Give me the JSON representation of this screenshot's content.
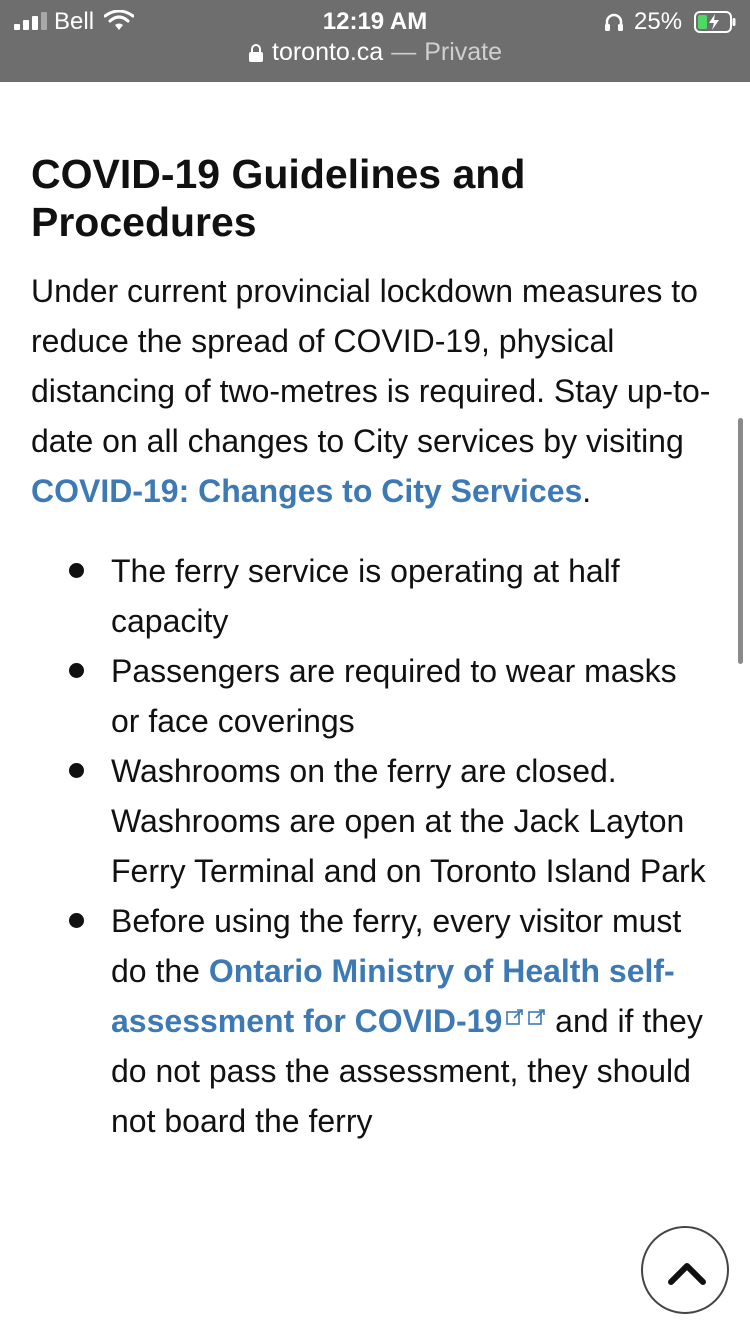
{
  "status_bar": {
    "carrier": "Bell",
    "time": "12:19 AM",
    "battery_percent": "25%",
    "signal_icon": "cellular-signal-icon",
    "wifi_icon": "wifi-icon",
    "headphones_icon": "headphones-icon",
    "battery_icon": "battery-charging-icon"
  },
  "url_bar": {
    "domain": "toronto.ca",
    "separator": "—",
    "mode": "Private",
    "lock_icon": "lock-icon"
  },
  "article": {
    "title": "COVID-19 Guidelines and Procedures",
    "intro_text": "Under current provincial lockdown measures to reduce the spread of COVID-19, physical distancing of two-metres is required. Stay up-to-date on all changes to City services by visiting ",
    "intro_link": "COVID-19: Changes to City Services",
    "intro_end": ".",
    "bullets": [
      {
        "text": "The ferry service is operating at half capacity"
      },
      {
        "text": "Passengers are required to wear masks or face coverings"
      },
      {
        "text": "Washrooms on the ferry are closed. Washrooms are open at the Jack Layton Ferry Terminal and on Toronto Island Park"
      },
      {
        "before": "Before using the ferry, every visitor must do the ",
        "link": "Ontario Ministry of Health self-assessment for COVID-19",
        "after": " and if they do not pass the assessment, they should not board the ferry"
      }
    ]
  },
  "back_to_top": {
    "icon": "chevron-up-icon"
  },
  "colors": {
    "topbar_bg": "#6e6e6e",
    "link": "#3d7ab5",
    "text": "#111111"
  }
}
